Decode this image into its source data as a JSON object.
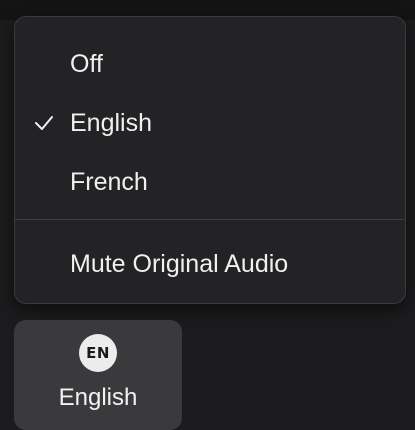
{
  "menu": {
    "items": [
      {
        "label": "Off",
        "selected": false
      },
      {
        "label": "English",
        "selected": true
      },
      {
        "label": "French",
        "selected": false
      }
    ],
    "mute_label": "Mute Original Audio",
    "check_icon": "checkmark-icon"
  },
  "language_button": {
    "badge": "EN",
    "label": "English"
  },
  "colors": {
    "background": "#1c1c1e",
    "menu_background": "#232325",
    "button_background": "#3a3a3c",
    "badge_background": "#ececec",
    "text": "#f2f2f2"
  }
}
